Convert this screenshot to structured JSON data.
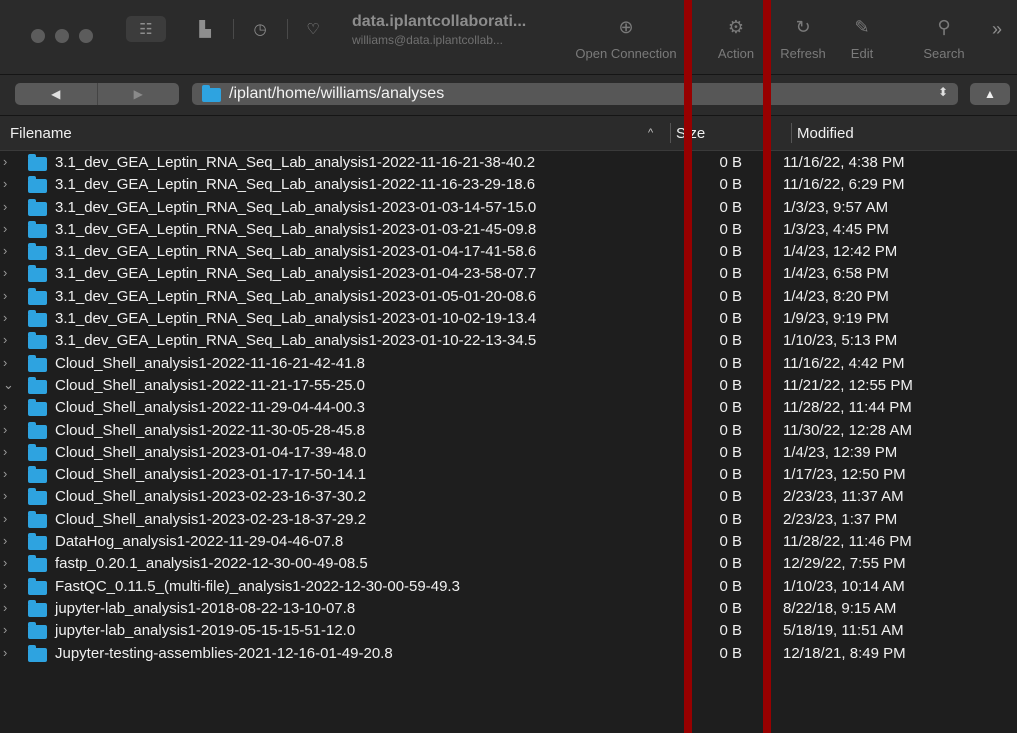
{
  "toolbar": {
    "connection_title": "data.iplantcollaborati...",
    "connection_user": "williams@data.iplantcollab...",
    "buttons": [
      {
        "label": "Open Connection",
        "icon": "globe-plus-icon"
      },
      {
        "label": "Action",
        "icon": "gear-icon"
      },
      {
        "label": "Refresh",
        "icon": "refresh-icon"
      },
      {
        "label": "Edit",
        "icon": "pencil-icon"
      },
      {
        "label": "Search",
        "icon": "search-icon"
      }
    ]
  },
  "pathbar": {
    "path": "/iplant/home/williams/analyses"
  },
  "columns": {
    "filename": "Filename",
    "size": "Size",
    "modified": "Modified"
  },
  "rows": [
    {
      "name": "3.1_dev_GEA_Leptin_RNA_Seq_Lab_analysis1-2022-11-16-21-38-40.2",
      "size": "0 B",
      "modified": "11/16/22, 4:38 PM",
      "expanded": false
    },
    {
      "name": "3.1_dev_GEA_Leptin_RNA_Seq_Lab_analysis1-2022-11-16-23-29-18.6",
      "size": "0 B",
      "modified": "11/16/22, 6:29 PM",
      "expanded": false
    },
    {
      "name": "3.1_dev_GEA_Leptin_RNA_Seq_Lab_analysis1-2023-01-03-14-57-15.0",
      "size": "0 B",
      "modified": "1/3/23, 9:57 AM",
      "expanded": false
    },
    {
      "name": "3.1_dev_GEA_Leptin_RNA_Seq_Lab_analysis1-2023-01-03-21-45-09.8",
      "size": "0 B",
      "modified": "1/3/23, 4:45 PM",
      "expanded": false
    },
    {
      "name": "3.1_dev_GEA_Leptin_RNA_Seq_Lab_analysis1-2023-01-04-17-41-58.6",
      "size": "0 B",
      "modified": "1/4/23, 12:42 PM",
      "expanded": false
    },
    {
      "name": "3.1_dev_GEA_Leptin_RNA_Seq_Lab_analysis1-2023-01-04-23-58-07.7",
      "size": "0 B",
      "modified": "1/4/23, 6:58 PM",
      "expanded": false
    },
    {
      "name": "3.1_dev_GEA_Leptin_RNA_Seq_Lab_analysis1-2023-01-05-01-20-08.6",
      "size": "0 B",
      "modified": "1/4/23, 8:20 PM",
      "expanded": false
    },
    {
      "name": "3.1_dev_GEA_Leptin_RNA_Seq_Lab_analysis1-2023-01-10-02-19-13.4",
      "size": "0 B",
      "modified": "1/9/23, 9:19 PM",
      "expanded": false
    },
    {
      "name": "3.1_dev_GEA_Leptin_RNA_Seq_Lab_analysis1-2023-01-10-22-13-34.5",
      "size": "0 B",
      "modified": "1/10/23, 5:13 PM",
      "expanded": false
    },
    {
      "name": "Cloud_Shell_analysis1-2022-11-16-21-42-41.8",
      "size": "0 B",
      "modified": "11/16/22, 4:42 PM",
      "expanded": false
    },
    {
      "name": "Cloud_Shell_analysis1-2022-11-21-17-55-25.0",
      "size": "0 B",
      "modified": "11/21/22, 12:55 PM",
      "expanded": true
    },
    {
      "name": "Cloud_Shell_analysis1-2022-11-29-04-44-00.3",
      "size": "0 B",
      "modified": "11/28/22, 11:44 PM",
      "expanded": false
    },
    {
      "name": "Cloud_Shell_analysis1-2022-11-30-05-28-45.8",
      "size": "0 B",
      "modified": "11/30/22, 12:28 AM",
      "expanded": false
    },
    {
      "name": "Cloud_Shell_analysis1-2023-01-04-17-39-48.0",
      "size": "0 B",
      "modified": "1/4/23, 12:39 PM",
      "expanded": false
    },
    {
      "name": "Cloud_Shell_analysis1-2023-01-17-17-50-14.1",
      "size": "0 B",
      "modified": "1/17/23, 12:50 PM",
      "expanded": false
    },
    {
      "name": "Cloud_Shell_analysis1-2023-02-23-16-37-30.2",
      "size": "0 B",
      "modified": "2/23/23, 11:37 AM",
      "expanded": false
    },
    {
      "name": "Cloud_Shell_analysis1-2023-02-23-18-37-29.2",
      "size": "0 B",
      "modified": "2/23/23, 1:37 PM",
      "expanded": false
    },
    {
      "name": "DataHog_analysis1-2022-11-29-04-46-07.8",
      "size": "0 B",
      "modified": "11/28/22, 11:46 PM",
      "expanded": false
    },
    {
      "name": "fastp_0.20.1_analysis1-2022-12-30-00-49-08.5",
      "size": "0 B",
      "modified": "12/29/22, 7:55 PM",
      "expanded": false
    },
    {
      "name": "FastQC_0.11.5_(multi-file)_analysis1-2022-12-30-00-59-49.3",
      "size": "0 B",
      "modified": "1/10/23, 10:14 AM",
      "expanded": false
    },
    {
      "name": "jupyter-lab_analysis1-2018-08-22-13-10-07.8",
      "size": "0 B",
      "modified": "8/22/18, 9:15 AM",
      "expanded": false
    },
    {
      "name": "jupyter-lab_analysis1-2019-05-15-15-51-12.0",
      "size": "0 B",
      "modified": "5/18/19, 11:51 AM",
      "expanded": false
    },
    {
      "name": "Jupyter-testing-assemblies-2021-12-16-01-49-20.8",
      "size": "0 B",
      "modified": "12/18/21, 8:49 PM",
      "expanded": false
    }
  ],
  "colors": {
    "folder": "#2ea3e0",
    "annotation_bar": "#970000",
    "background": "#1e1e1e"
  }
}
